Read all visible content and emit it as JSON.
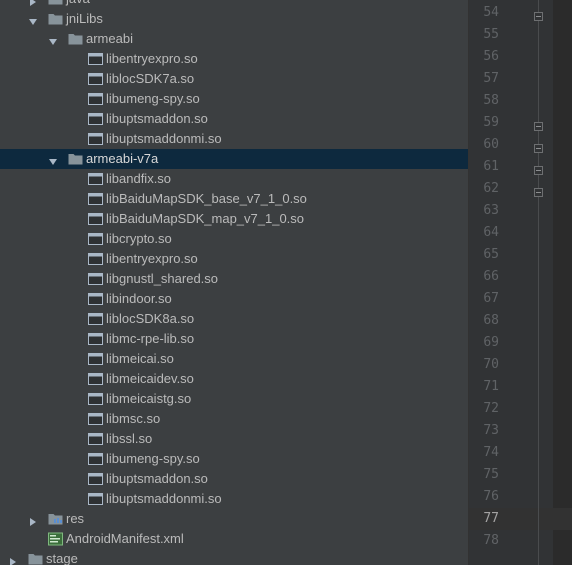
{
  "tree": {
    "items": [
      {
        "label": "java",
        "type": "folder",
        "expanded": false
      },
      {
        "label": "jniLibs",
        "type": "folder",
        "expanded": true
      },
      {
        "label": "armeabi",
        "type": "folder",
        "expanded": true
      },
      {
        "label": "libentryexpro.so",
        "type": "file"
      },
      {
        "label": "liblocSDK7a.so",
        "type": "file"
      },
      {
        "label": "libumeng-spy.so",
        "type": "file"
      },
      {
        "label": "libuptsmaddon.so",
        "type": "file"
      },
      {
        "label": "libuptsmaddonmi.so",
        "type": "file"
      },
      {
        "label": "armeabi-v7a",
        "type": "folder",
        "expanded": true,
        "selected": true
      },
      {
        "label": "libandfix.so",
        "type": "file"
      },
      {
        "label": "libBaiduMapSDK_base_v7_1_0.so",
        "type": "file"
      },
      {
        "label": "libBaiduMapSDK_map_v7_1_0.so",
        "type": "file"
      },
      {
        "label": "libcrypto.so",
        "type": "file"
      },
      {
        "label": "libentryexpro.so",
        "type": "file"
      },
      {
        "label": "libgnustl_shared.so",
        "type": "file"
      },
      {
        "label": "libindoor.so",
        "type": "file"
      },
      {
        "label": "liblocSDK8a.so",
        "type": "file"
      },
      {
        "label": "libmc-rpe-lib.so",
        "type": "file"
      },
      {
        "label": "libmeicai.so",
        "type": "file"
      },
      {
        "label": "libmeicaidev.so",
        "type": "file"
      },
      {
        "label": "libmeicaistg.so",
        "type": "file"
      },
      {
        "label": "libmsc.so",
        "type": "file"
      },
      {
        "label": "libssl.so",
        "type": "file"
      },
      {
        "label": "libumeng-spy.so",
        "type": "file"
      },
      {
        "label": "libuptsmaddon.so",
        "type": "file"
      },
      {
        "label": "libuptsmaddonmi.so",
        "type": "file"
      },
      {
        "label": "res",
        "type": "res-folder",
        "expanded": false
      },
      {
        "label": "AndroidManifest.xml",
        "type": "manifest"
      },
      {
        "label": "stage",
        "type": "folder",
        "expanded": false
      }
    ]
  },
  "gutter": {
    "lines": [
      "54",
      "55",
      "56",
      "57",
      "58",
      "59",
      "60",
      "61",
      "62",
      "63",
      "64",
      "65",
      "66",
      "67",
      "68",
      "69",
      "70",
      "71",
      "72",
      "73",
      "74",
      "75",
      "76",
      "77",
      "78"
    ],
    "current_line": "77",
    "fold_markers": [
      "54",
      "59",
      "60",
      "61",
      "62"
    ]
  },
  "colors": {
    "tree_bg": "#3c3f41",
    "selection_bg": "#0d293e",
    "text": "#bbbbbb",
    "folder": "#87939a",
    "gutter_bg": "#313335",
    "line_number": "#606366",
    "editor_bg": "#2b2b2b"
  }
}
